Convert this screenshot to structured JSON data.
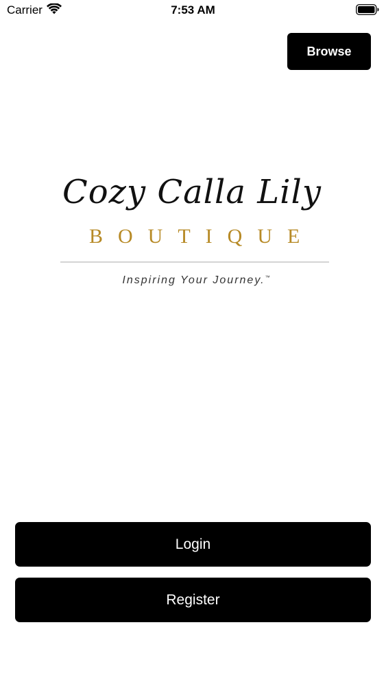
{
  "status_bar": {
    "carrier": "Carrier",
    "time": "7:53 AM",
    "wifi_icon": "wifi-icon",
    "battery_icon": "battery-icon"
  },
  "header": {
    "browse_label": "Browse"
  },
  "logo": {
    "script_text": "Cozy Calla Lily",
    "subtitle": "BOUTIQUE",
    "tagline": "Inspiring Your Journey.",
    "trademark": "™",
    "accent_color": "#b78a26"
  },
  "actions": {
    "login_label": "Login",
    "register_label": "Register"
  },
  "colors": {
    "button_background": "#000000",
    "button_text": "#ffffff",
    "page_background": "#ffffff"
  }
}
